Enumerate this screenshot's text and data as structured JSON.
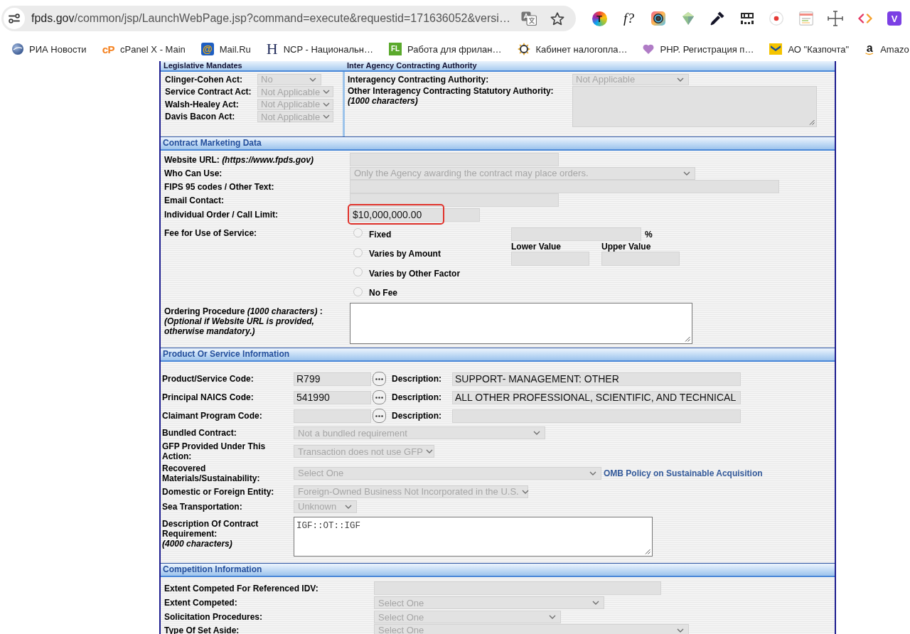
{
  "browser": {
    "address_bar": {
      "domain": "fpds.gov",
      "path": "/common/jsp/LaunchWebPage.jsp?command=execute&requestid=171636052&versi…"
    },
    "extensions": [
      {
        "kind": "rainbow-letter",
        "glyph": "T"
      },
      {
        "kind": "italic-letters",
        "glyph": "f?"
      },
      {
        "kind": "lens"
      },
      {
        "kind": "gem"
      },
      {
        "kind": "eyedropper"
      },
      {
        "kind": "ruler"
      },
      {
        "kind": "record"
      },
      {
        "kind": "notepad"
      },
      {
        "kind": "move"
      },
      {
        "kind": "code"
      },
      {
        "kind": "letter-square",
        "glyph": "V"
      }
    ],
    "bookmarks": [
      {
        "kind": "globe",
        "label": "РИА Новости"
      },
      {
        "kind": "orange-letters",
        "glyph": "cP",
        "label": "cPanel X - Main"
      },
      {
        "kind": "at-tile",
        "glyph": "@",
        "label": "Mail.Ru"
      },
      {
        "kind": "serif-letter",
        "glyph": "H",
        "label": "NCP - Национальн…"
      },
      {
        "kind": "letter-tile",
        "glyph": "FL",
        "label": "Работа для фрилан…"
      },
      {
        "kind": "sun",
        "label": "Кабинет налогопла…"
      },
      {
        "kind": "heart",
        "label": "PHP. Регистрация п…"
      },
      {
        "kind": "envelope",
        "label": "АО \"Казпочта\""
      },
      {
        "kind": "smile-letter",
        "glyph": "a",
        "label": "Amazo"
      }
    ]
  },
  "form": {
    "legislative": {
      "mandates_title": "Legislative Mandates",
      "authority_title": "Inter Agency Contracting Authority",
      "mandates": [
        {
          "label": "Clinger-Cohen Act:",
          "value": "No",
          "disabled": true
        },
        {
          "label": "Service Contract Act:",
          "value": "Not Applicable",
          "disabled": true
        },
        {
          "label": "Walsh-Healey Act:",
          "value": "Not Applicable",
          "disabled": true
        },
        {
          "label": "Davis Bacon Act:",
          "value": "Not Applicable",
          "disabled": true
        }
      ],
      "authority": {
        "label": "Interagency Contracting Authority:",
        "value": "Not Applicable",
        "disabled": true
      },
      "statutory": {
        "label": "Other Interagency Contracting Statutory Authority:",
        "note": "(1000 characters)",
        "disabled": true
      }
    },
    "sections": [
      {
        "title": "Contract Marketing Data",
        "fields": [
          {
            "kind": "input",
            "label": "Website URL: *(https://www.fpds.gov)*",
            "disabled": true,
            "highlighted": false
          },
          {
            "kind": "select",
            "label": "Who Can Use:",
            "value": "Only the Agency awarding the contract may place orders.",
            "disabled": true,
            "highlighted": false
          },
          {
            "kind": "input",
            "label": "FIPS 95 codes / Other Text:",
            "disabled": true,
            "highlighted": false
          },
          {
            "kind": "input",
            "label": "Email Contact:",
            "disabled": true,
            "highlighted": false
          },
          {
            "kind": "input",
            "label": "Individual Order / Call Limit:",
            "value": "$10,000,000.00",
            "disabled": true,
            "highlighted": true
          },
          {
            "kind": "fee",
            "label": "Fee for Use of Service:",
            "disabled": true,
            "highlighted": false,
            "options": [
              {
                "label": "Fixed",
                "selected": false
              },
              {
                "label": "Varies by Amount",
                "selected": false
              },
              {
                "label": "Varies by Other Factor",
                "selected": false
              },
              {
                "label": "No Fee",
                "selected": false
              }
            ],
            "fixed_unit": "%",
            "range_labels": [
              "Lower Value",
              "Upper Value"
            ]
          },
          {
            "kind": "textarea",
            "label": "Ordering Procedure *(1000 characters)* :",
            "note": "(Optional if Website URL is provided, otherwise mandatory.)",
            "disabled": false,
            "highlighted": false
          }
        ]
      },
      {
        "title": "Product Or Service Information",
        "fields": [
          {
            "kind": "code",
            "label": "Product/Service Code:",
            "value": "R799",
            "description_label": "Description:",
            "description": "SUPPORT- MANAGEMENT: OTHER",
            "disabled": true
          },
          {
            "kind": "code",
            "label": "Principal NAICS Code:",
            "value": "541990",
            "description_label": "Description:",
            "description": "ALL OTHER PROFESSIONAL, SCIENTIFIC, AND TECHNICAL",
            "disabled": true
          },
          {
            "kind": "code",
            "label": "Claimant Program Code:",
            "description_label": "Description:",
            "disabled": true
          },
          {
            "kind": "select",
            "label": "Bundled Contract:",
            "value": "Not a bundled requirement",
            "disabled": true
          },
          {
            "kind": "select",
            "label": "GFP Provided Under This Action:",
            "value": "Transaction does not use GFP",
            "disabled": true
          },
          {
            "kind": "select",
            "label": "Recovered Materials/Sustainability:",
            "value": "Select One",
            "disabled": true,
            "link": "OMB Policy on Sustainable Acquisition"
          },
          {
            "kind": "select",
            "label": "Domestic or Foreign Entity:",
            "value": "Foreign-Owned Business Not Incorporated in the U.S.",
            "disabled": true
          },
          {
            "kind": "select",
            "label": "Sea Transportation:",
            "value": "Unknown",
            "disabled": true
          },
          {
            "kind": "textarea",
            "label": "Description Of Contract Requirement:",
            "note": "(4000 characters)",
            "value": "IGF::OT::IGF",
            "disabled": false
          }
        ]
      },
      {
        "title": "Competition Information",
        "fields": [
          {
            "kind": "input",
            "label": "Extent Competed For Referenced IDV:",
            "disabled": true
          },
          {
            "kind": "select",
            "label": "Extent Competed:",
            "value": "Select One",
            "disabled": true
          },
          {
            "kind": "select",
            "label": "Solicitation Procedures:",
            "value": "Select One",
            "disabled": true
          },
          {
            "kind": "select",
            "label": "Type Of Set Aside:",
            "value": "Select One",
            "disabled": true
          }
        ]
      }
    ]
  }
}
